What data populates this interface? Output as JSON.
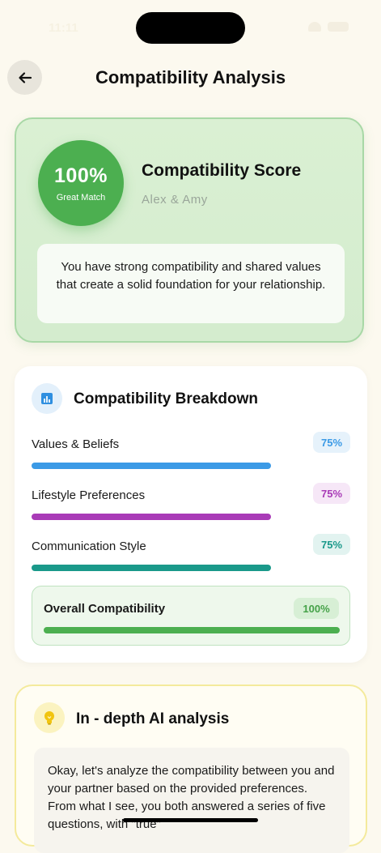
{
  "status_bar": {
    "time": "11:11"
  },
  "header": {
    "title": "Compatibility Analysis"
  },
  "score_card": {
    "percent": "100%",
    "match_label": "Great Match",
    "title": "Compatibility Score",
    "names": "Alex & Amy",
    "description": "You have strong compatibility and shared values that create a solid foundation for your relationship.",
    "accent_color": "#4caf50"
  },
  "breakdown": {
    "title": "Compatibility Breakdown",
    "icon": "chart-icon",
    "metrics": [
      {
        "label": "Values & Beliefs",
        "value": "75%",
        "progress": 0.75,
        "color": "#3b9ae6",
        "badge_bg": "#e6f2fb",
        "badge_color": "#3b9ae6"
      },
      {
        "label": "Lifestyle Preferences",
        "value": "75%",
        "progress": 0.75,
        "color": "#a93bb7",
        "badge_bg": "#f6e7f7",
        "badge_color": "#a93bb7"
      },
      {
        "label": "Communication Style",
        "value": "75%",
        "progress": 0.75,
        "color": "#1a998a",
        "badge_bg": "#e2f3f0",
        "badge_color": "#1a998a"
      }
    ],
    "overall": {
      "label": "Overall Compatibility",
      "value": "100%",
      "progress": 1.0
    }
  },
  "ai_analysis": {
    "title": "In - depth AI analysis",
    "icon": "lightbulb-icon",
    "body": "Okay, let's analyze the compatibility between you and your partner based on the provided preferences. From what I see, you both answered a series of five questions, with \"true\""
  }
}
